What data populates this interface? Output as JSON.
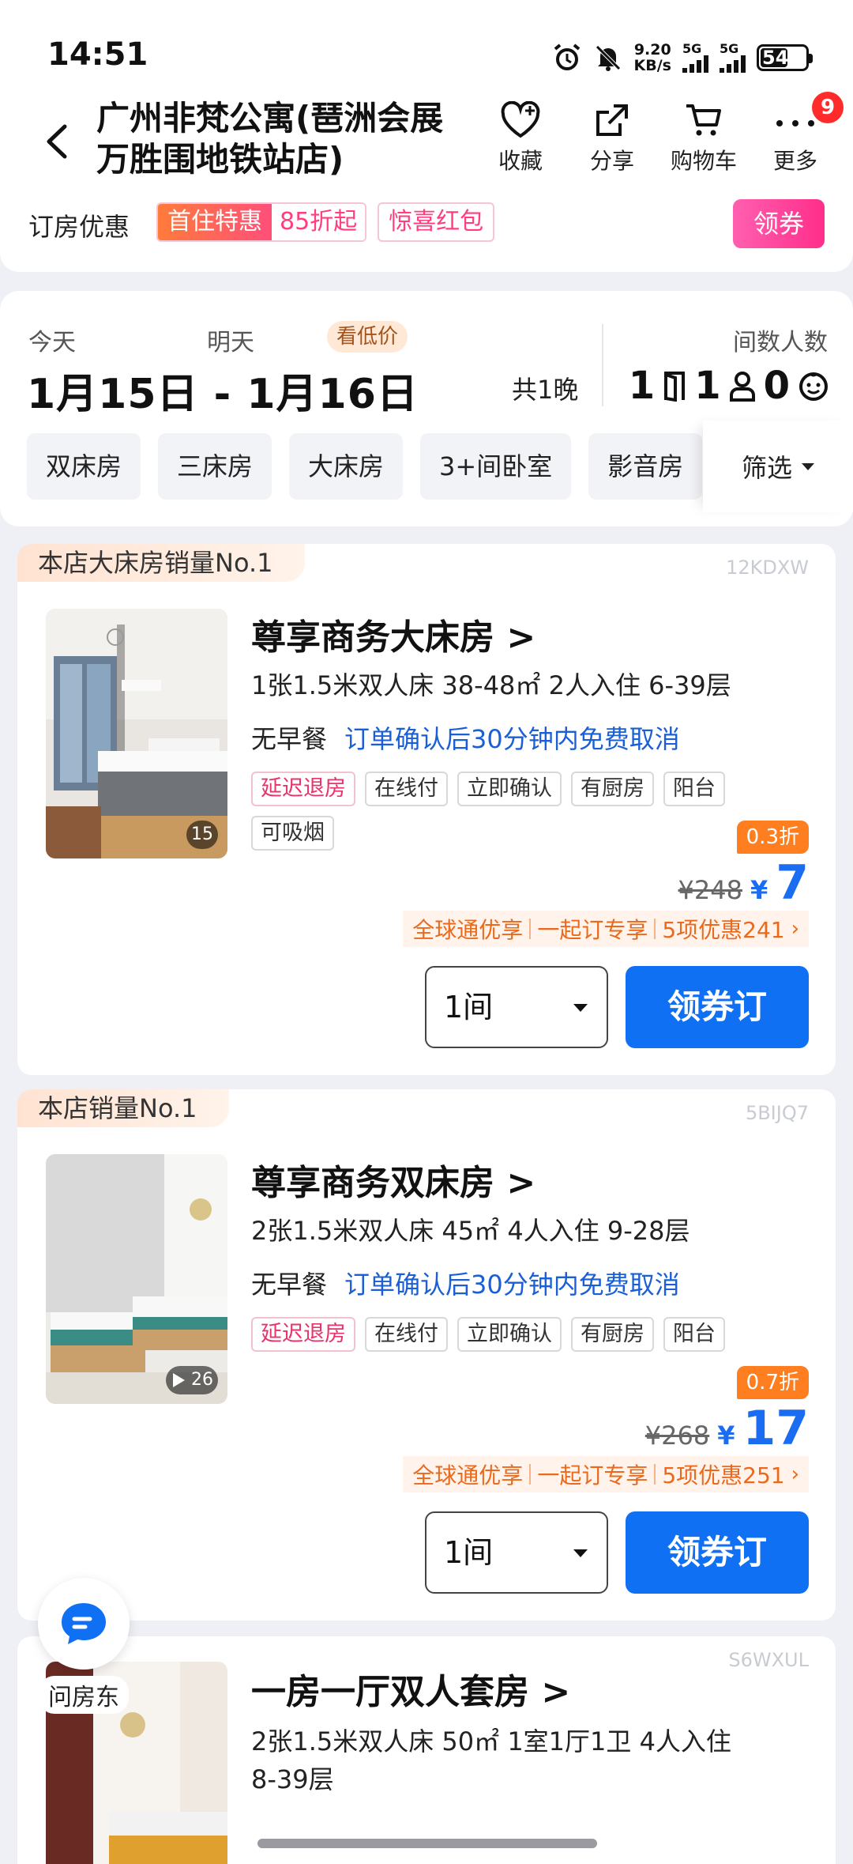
{
  "status_bar": {
    "time": "14:51",
    "net_speed_value": "9.20",
    "net_speed_unit": "KB/s",
    "sim1": "5G",
    "sim2": "5G",
    "battery": "54"
  },
  "header": {
    "hotel_name": "广州非梵公寓(琶洲会展万胜围地铁站店)",
    "actions": [
      {
        "label": "收藏",
        "icon": "heart-icon"
      },
      {
        "label": "分享",
        "icon": "share-icon"
      },
      {
        "label": "购物车",
        "icon": "cart-icon"
      },
      {
        "label": "更多",
        "icon": "more-icon"
      }
    ],
    "more_badge": "9"
  },
  "discount_bar": {
    "label": "订房优惠",
    "combo_tag_a": "首住特惠",
    "combo_tag_b": "85折起",
    "surprise_tag": "惊喜红包",
    "coupon_button": "领券"
  },
  "dates": {
    "today_label": "今天",
    "tomorrow_label": "明天",
    "low_price_tag": "看低价",
    "range": "1月15日 - 1月16日",
    "nights": "共1晚",
    "rooms_people_label": "间数人数",
    "rooms": "1",
    "adults": "1",
    "children": "0"
  },
  "filters": {
    "chips": [
      "双床房",
      "三床房",
      "大床房",
      "3+间卧室",
      "影音房"
    ],
    "filter_button": "筛选"
  },
  "rooms": [
    {
      "rank_tag": "本店大床房销量No.1",
      "code": "12KDXW",
      "name": "尊享商务大床房 >",
      "spec": "1张1.5米双人床  38-48㎡  2人入住  6-39层",
      "meal": "无早餐",
      "cancel": "订单确认后30分钟内免费取消",
      "tags": [
        "延迟退房",
        "在线付",
        "立即确认",
        "有厨房",
        "阳台",
        "可吸烟"
      ],
      "image_count": "15",
      "discount": "0.3折",
      "orig_price": "¥248",
      "currency": "¥",
      "price": "7",
      "promos": [
        "全球通优享",
        "一起订专享",
        "5项优惠241"
      ],
      "qty": "1间",
      "book_label": "领券订"
    },
    {
      "rank_tag": "本店销量No.1",
      "code": "5BIJQ7",
      "name": "尊享商务双床房 >",
      "spec": "2张1.5米双人床  45㎡  4人入住  9-28层",
      "meal": "无早餐",
      "cancel": "订单确认后30分钟内免费取消",
      "tags": [
        "延迟退房",
        "在线付",
        "立即确认",
        "有厨房",
        "阳台"
      ],
      "image_count": "26",
      "discount": "0.7折",
      "orig_price": "¥268",
      "currency": "¥",
      "price": "17",
      "promos": [
        "全球通优享",
        "一起订专享",
        "5项优惠251"
      ],
      "qty": "1间",
      "book_label": "领券订"
    },
    {
      "code": "S6WXUL",
      "name": "一房一厅双人套房 >",
      "spec_line1": "2张1.5米双人床  50㎡  1室1厅1卫  4人入住",
      "spec_line2": "8-39层"
    }
  ],
  "chat": {
    "label": "问房东"
  },
  "colors": {
    "accent_blue": "#1070f4",
    "promo_orange": "#ff7e1f",
    "pink": "#ff2e8a"
  }
}
